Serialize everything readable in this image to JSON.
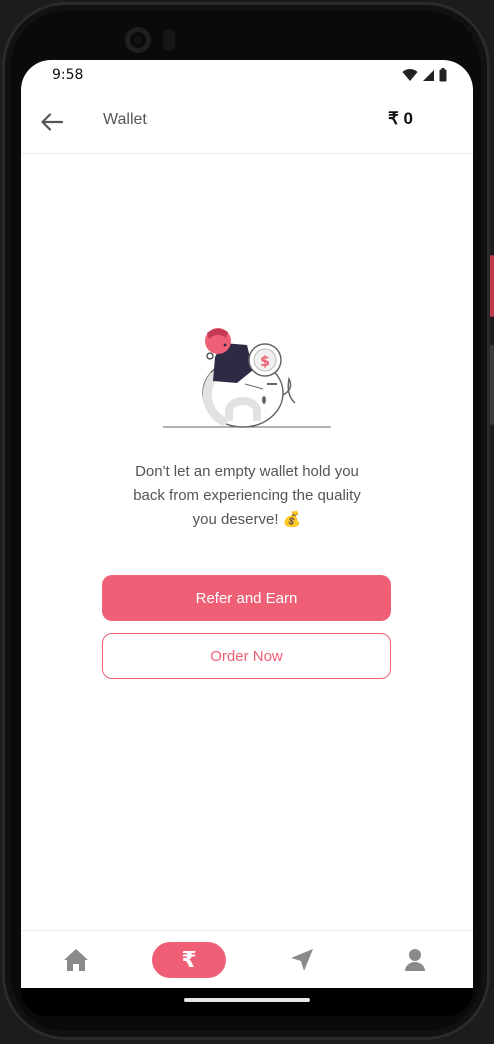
{
  "status_bar": {
    "time": "9:58",
    "icons": [
      "wifi-icon",
      "signal-icon",
      "battery-icon"
    ]
  },
  "app_bar": {
    "title": "Wallet",
    "balance": "₹ 0",
    "back_icon": "arrow-left-icon"
  },
  "empty_state": {
    "illustration": "piggy-bank-illustration",
    "message_line1": "Don't let an empty wallet hold you",
    "message_line2": "back from experiencing the quality",
    "message_line3": "you deserve! 💰"
  },
  "actions": {
    "primary_label": "Refer and Earn",
    "secondary_label": "Order Now"
  },
  "bottom_nav": {
    "items": [
      {
        "icon": "home-icon",
        "active": false
      },
      {
        "icon": "rupee-icon",
        "glyph": "₹",
        "active": true
      },
      {
        "icon": "navigation-icon",
        "active": false
      },
      {
        "icon": "profile-icon",
        "active": false
      }
    ]
  },
  "colors": {
    "accent": "#ef5f75",
    "text_muted": "#555555",
    "nav_icon": "#8a8a8a"
  }
}
